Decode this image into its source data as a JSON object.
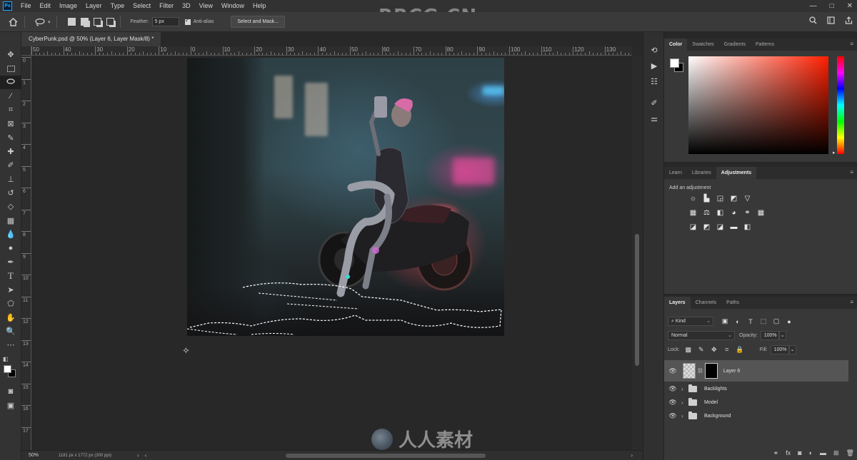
{
  "app": {
    "logo_text": "Ps",
    "menu": [
      "File",
      "Edit",
      "Image",
      "Layer",
      "Type",
      "Select",
      "Filter",
      "3D",
      "View",
      "Window",
      "Help"
    ],
    "window_controls": [
      "—",
      "□",
      "✕"
    ]
  },
  "watermark": {
    "top_text": "RRCG.CN",
    "bottom_text": "人人素材"
  },
  "options_bar": {
    "home_icon": "home-icon",
    "tool_icon": "lasso-icon",
    "feather_label": "Feather:",
    "feather_value": "5 px",
    "anti_alias_label": "Anti-alias",
    "select_mask_label": "Select and Mask..."
  },
  "document": {
    "tab_title": "CyberPunk.psd @ 50% (Layer 6, Layer Mask/8) *"
  },
  "ruler": {
    "h_labels": [
      "50",
      "40",
      "30",
      "20",
      "10",
      "0",
      "10",
      "20",
      "30",
      "40",
      "50",
      "60",
      "70",
      "80",
      "90",
      "100",
      "110",
      "120",
      "130"
    ],
    "v_labels": [
      "0",
      "1",
      "2",
      "3",
      "4",
      "5",
      "6",
      "7",
      "8",
      "9",
      "10",
      "11",
      "12",
      "13",
      "14",
      "15",
      "16",
      "17"
    ]
  },
  "status": {
    "zoom": "50%",
    "doc_info": "1181 px x 1772 px (300 ppi)"
  },
  "color_panel": {
    "tabs": [
      "Color",
      "Swatches",
      "Gradients",
      "Patterns"
    ],
    "active_tab": "Color"
  },
  "adjust_panel": {
    "tabs": [
      "Learn",
      "Libraries",
      "Adjustments"
    ],
    "active_tab": "Adjustments",
    "title": "Add an adjustment"
  },
  "layers_panel": {
    "tabs": [
      "Layers",
      "Channels",
      "Paths"
    ],
    "active_tab": "Layers",
    "kind_label": "Kind",
    "blend_mode": "Normal",
    "opacity_label": "Opacity:",
    "opacity_value": "100%",
    "lock_label": "Lock:",
    "fill_label": "Fill:",
    "fill_value": "100%",
    "layers": [
      {
        "name": "Layer 6",
        "type": "layer",
        "selected": true
      },
      {
        "name": "Backlights",
        "type": "group",
        "selected": false
      },
      {
        "name": "Model",
        "type": "group",
        "selected": false
      },
      {
        "name": "Background",
        "type": "group",
        "selected": false
      }
    ]
  }
}
